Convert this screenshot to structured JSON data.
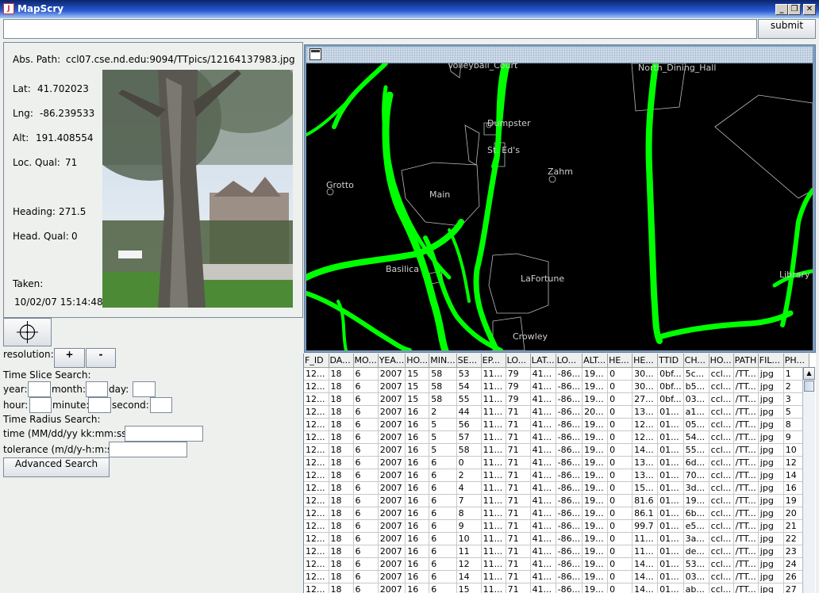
{
  "window": {
    "title": "MapScry",
    "icon": "java-cup-icon",
    "controls": {
      "minimize": "_",
      "maximize": "❐",
      "close": "✕"
    }
  },
  "top": {
    "query_value": "",
    "submit_label": "submit"
  },
  "info": {
    "abs_path_label": "Abs. Path:",
    "abs_path": "ccl07.cse.nd.edu:9094/TTpics/12164137983.jpg",
    "lat_label": "Lat:",
    "lat": "41.702023",
    "lng_label": "Lng:",
    "lng": "-86.239533",
    "alt_label": "Alt:",
    "alt": "191.408554",
    "locqual_label": "Loc. Qual:",
    "locqual": "71",
    "heading_label": "Heading:",
    "heading": "271.5",
    "headqual_label": "Head. Qual:",
    "headqual": "0",
    "taken_label": "Taken:",
    "taken": "10/02/07 15:14:48"
  },
  "controls": {
    "center_icon": "crosshair-icon",
    "resolution_label": "resolution:",
    "plus": "+",
    "minus": "-",
    "time_slice_label": "Time Slice Search:",
    "year_label": "year:",
    "month_label": "month:",
    "day_label": "day:",
    "hour_label": "hour:",
    "minute_label": "minute:",
    "second_label": "second:",
    "time_radius_label": "Time Radius Search:",
    "time_label": "time (MM/dd/yy kk:mm:ss):",
    "tolerance_label": "tolerance (m/d/y-h:m:s):",
    "advanced_label": "Advanced Search"
  },
  "map": {
    "labels": [
      "Volleyball_Court",
      "North_Dining_Hall",
      "Dumpster",
      "St. Ed's",
      "Zahm",
      "Grotto",
      "Main",
      "Basilica",
      "LaFortune",
      "Library",
      "Crowley"
    ],
    "path_color": "#00ff00"
  },
  "table": {
    "columns": [
      "F_ID",
      "DA...",
      "MO...",
      "YEA...",
      "HO...",
      "MIN...",
      "SE...",
      "EP...",
      "LO...",
      "LAT...",
      "LO...",
      "ALT...",
      "HE...",
      "HE...",
      "TTID",
      "CH...",
      "HO...",
      "PATH",
      "FIL...",
      "PH..."
    ],
    "rows": [
      [
        "12...",
        "18",
        "6",
        "2007",
        "15",
        "58",
        "53",
        "11...",
        "79",
        "41...",
        "-86...",
        "19...",
        "0",
        "30...",
        "0bf...",
        "5c...",
        "ccl...",
        "/TT...",
        "jpg",
        "1"
      ],
      [
        "12...",
        "18",
        "6",
        "2007",
        "15",
        "58",
        "54",
        "11...",
        "79",
        "41...",
        "-86...",
        "19...",
        "0",
        "30...",
        "0bf...",
        "b5...",
        "ccl...",
        "/TT...",
        "jpg",
        "2"
      ],
      [
        "12...",
        "18",
        "6",
        "2007",
        "15",
        "58",
        "55",
        "11...",
        "79",
        "41...",
        "-86...",
        "19...",
        "0",
        "27...",
        "0bf...",
        "03...",
        "ccl...",
        "/TT...",
        "jpg",
        "3"
      ],
      [
        "12...",
        "18",
        "6",
        "2007",
        "16",
        "2",
        "44",
        "11...",
        "71",
        "41...",
        "-86...",
        "20...",
        "0",
        "13...",
        "01...",
        "a1...",
        "ccl...",
        "/TT...",
        "jpg",
        "5"
      ],
      [
        "12...",
        "18",
        "6",
        "2007",
        "16",
        "5",
        "56",
        "11...",
        "71",
        "41...",
        "-86...",
        "19...",
        "0",
        "12...",
        "01...",
        "05...",
        "ccl...",
        "/TT...",
        "jpg",
        "8"
      ],
      [
        "12...",
        "18",
        "6",
        "2007",
        "16",
        "5",
        "57",
        "11...",
        "71",
        "41...",
        "-86...",
        "19...",
        "0",
        "12...",
        "01...",
        "54...",
        "ccl...",
        "/TT...",
        "jpg",
        "9"
      ],
      [
        "12...",
        "18",
        "6",
        "2007",
        "16",
        "5",
        "58",
        "11...",
        "71",
        "41...",
        "-86...",
        "19...",
        "0",
        "14...",
        "01...",
        "55...",
        "ccl...",
        "/TT...",
        "jpg",
        "10"
      ],
      [
        "12...",
        "18",
        "6",
        "2007",
        "16",
        "6",
        "0",
        "11...",
        "71",
        "41...",
        "-86...",
        "19...",
        "0",
        "13...",
        "01...",
        "6d...",
        "ccl...",
        "/TT...",
        "jpg",
        "12"
      ],
      [
        "12...",
        "18",
        "6",
        "2007",
        "16",
        "6",
        "2",
        "11...",
        "71",
        "41...",
        "-86...",
        "19...",
        "0",
        "13...",
        "01...",
        "70...",
        "ccl...",
        "/TT...",
        "jpg",
        "14"
      ],
      [
        "12...",
        "18",
        "6",
        "2007",
        "16",
        "6",
        "4",
        "11...",
        "71",
        "41...",
        "-86...",
        "19...",
        "0",
        "15...",
        "01...",
        "3d...",
        "ccl...",
        "/TT...",
        "jpg",
        "16"
      ],
      [
        "12...",
        "18",
        "6",
        "2007",
        "16",
        "6",
        "7",
        "11...",
        "71",
        "41...",
        "-86...",
        "19...",
        "0",
        "81.6",
        "01...",
        "19...",
        "ccl...",
        "/TT...",
        "jpg",
        "19"
      ],
      [
        "12...",
        "18",
        "6",
        "2007",
        "16",
        "6",
        "8",
        "11...",
        "71",
        "41...",
        "-86...",
        "19...",
        "0",
        "86.1",
        "01...",
        "6b...",
        "ccl...",
        "/TT...",
        "jpg",
        "20"
      ],
      [
        "12...",
        "18",
        "6",
        "2007",
        "16",
        "6",
        "9",
        "11...",
        "71",
        "41...",
        "-86...",
        "19...",
        "0",
        "99.7",
        "01...",
        "e5...",
        "ccl...",
        "/TT...",
        "jpg",
        "21"
      ],
      [
        "12...",
        "18",
        "6",
        "2007",
        "16",
        "6",
        "10",
        "11...",
        "71",
        "41...",
        "-86...",
        "19...",
        "0",
        "11...",
        "01...",
        "3a...",
        "ccl...",
        "/TT...",
        "jpg",
        "22"
      ],
      [
        "12...",
        "18",
        "6",
        "2007",
        "16",
        "6",
        "11",
        "11...",
        "71",
        "41...",
        "-86...",
        "19...",
        "0",
        "11...",
        "01...",
        "de...",
        "ccl...",
        "/TT...",
        "jpg",
        "23"
      ],
      [
        "12...",
        "18",
        "6",
        "2007",
        "16",
        "6",
        "12",
        "11...",
        "71",
        "41...",
        "-86...",
        "19...",
        "0",
        "14...",
        "01...",
        "53...",
        "ccl...",
        "/TT...",
        "jpg",
        "24"
      ],
      [
        "12...",
        "18",
        "6",
        "2007",
        "16",
        "6",
        "14",
        "11...",
        "71",
        "41...",
        "-86...",
        "19...",
        "0",
        "14...",
        "01...",
        "03...",
        "ccl...",
        "/TT...",
        "jpg",
        "26"
      ],
      [
        "12...",
        "18",
        "6",
        "2007",
        "16",
        "6",
        "15",
        "11...",
        "71",
        "41...",
        "-86...",
        "19...",
        "0",
        "14...",
        "01...",
        "ab...",
        "ccl...",
        "/TT...",
        "jpg",
        "27"
      ]
    ]
  }
}
